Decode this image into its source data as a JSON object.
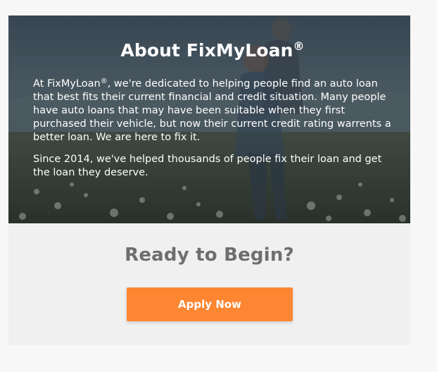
{
  "about": {
    "title": "About FixMyLoan",
    "title_mark": "®",
    "paragraph1_prefix": "At FixMyLoan",
    "paragraph1_mark": "®",
    "paragraph1_rest": ", we're dedicated to helping people find an auto loan that best fits their current financial and credit situation.  Many people have auto loans that may have been suitable when they first purchased their vehicle, but now their current credit rating warrents a better loan.  We are here to fix it.",
    "paragraph2": "Since 2014, we've helped thousands of people fix their loan and get the loan they deserve."
  },
  "cta": {
    "title": "Ready to Begin?",
    "button_label": "Apply Now"
  },
  "colors": {
    "accent": "#fd8633",
    "cta_title": "#6e6e6e",
    "cta_background": "#f0f0f0"
  }
}
